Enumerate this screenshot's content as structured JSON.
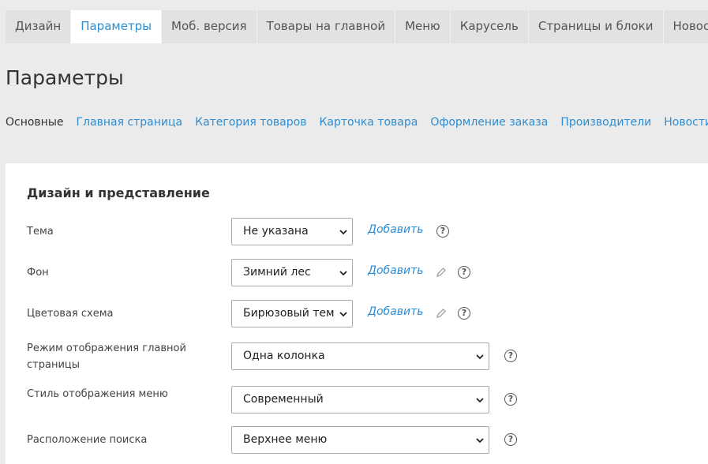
{
  "tabs": [
    {
      "label": "Дизайн"
    },
    {
      "label": "Параметры"
    },
    {
      "label": "Моб. версия"
    },
    {
      "label": "Товары на главной"
    },
    {
      "label": "Меню"
    },
    {
      "label": "Карусель"
    },
    {
      "label": "Страницы и блоки"
    },
    {
      "label": "Новости"
    }
  ],
  "active_tab": "Параметры",
  "page_title": "Параметры",
  "subnav": [
    {
      "label": "Основные"
    },
    {
      "label": "Главная страница"
    },
    {
      "label": "Категория товаров"
    },
    {
      "label": "Карточка товара"
    },
    {
      "label": "Оформление заказа"
    },
    {
      "label": "Производители"
    },
    {
      "label": "Новости"
    }
  ],
  "section": {
    "title": "Дизайн и представление",
    "rows": [
      {
        "label": "Тема",
        "value": "Не указана",
        "add": "Добавить",
        "help": "?"
      },
      {
        "label": "Фон",
        "value": "Зимний лес",
        "add": "Добавить",
        "help": "?"
      },
      {
        "label": "Цветовая схема",
        "value": "Бирюзовый тем",
        "add": "Добавить",
        "help": "?"
      },
      {
        "label": "Режим отображения главной страницы",
        "value": "Одна колонка",
        "help": "?"
      },
      {
        "label": "Стиль отображения меню",
        "value": "Современный",
        "help": "?"
      },
      {
        "label": "Расположение поиска",
        "value": "Верхнее меню",
        "help": "?"
      }
    ]
  },
  "icons": {
    "dropdown": "chevron-down-icon",
    "edit": "pencil-icon",
    "help": "question-circle-icon"
  },
  "colors": {
    "accent": "#2f8ccf",
    "background": "#ebebeb",
    "panel": "#ffffff"
  }
}
